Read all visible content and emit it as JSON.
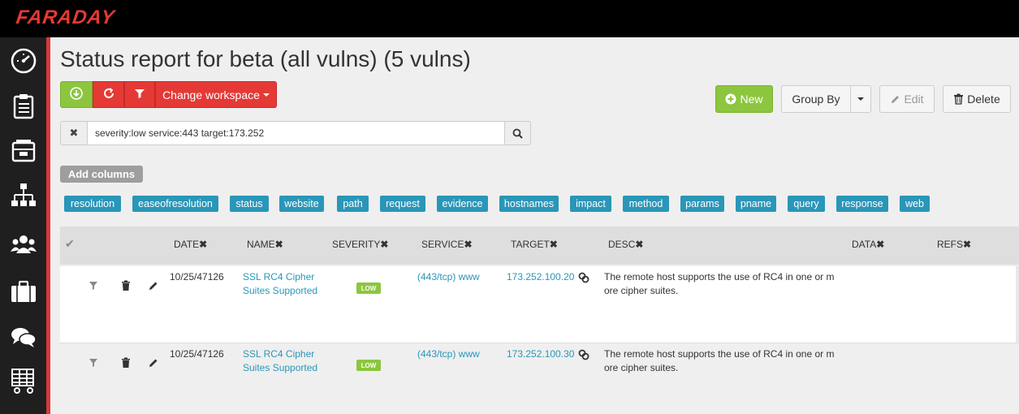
{
  "app": {
    "brand": "FARADAY"
  },
  "page": {
    "title": "Status report for beta (all vulns) (5 vulns)"
  },
  "toolbar": {
    "change_workspace_label": "Change workspace",
    "new_label": "New",
    "group_by_label": "Group By",
    "edit_label": "Edit",
    "delete_label": "Delete"
  },
  "search": {
    "value": "severity:low service:443 target:173.252",
    "clear_glyph": "✖"
  },
  "columns": {
    "add_label": "Add columns",
    "available": [
      "resolution",
      "easeofresolution",
      "status",
      "website",
      "path",
      "request",
      "evidence",
      "hostnames",
      "impact",
      "method",
      "params",
      "pname",
      "query",
      "response",
      "web"
    ]
  },
  "table": {
    "check_glyph": "✔",
    "remove_glyph": "✖",
    "headers": [
      "DATE",
      "NAME",
      "SEVERITY",
      "SERVICE",
      "TARGET",
      "DESC",
      "DATA",
      "REFS"
    ],
    "rows": [
      {
        "date": "10/25/47126",
        "name_line1": "SSL RC4 Cipher",
        "name_line2": "Suites Supported",
        "severity": "LOW",
        "service": "(443/tcp) www",
        "target": "173.252.100.20",
        "desc_line1": "The remote host supports the use of RC4 in one or m",
        "desc_line2": "ore cipher suites."
      },
      {
        "date": "10/25/47126",
        "name_line1": "SSL RC4 Cipher",
        "name_line2": "Suites Supported",
        "severity": "LOW",
        "service": "(443/tcp) www",
        "target": "173.252.100.30",
        "desc_line1": "The remote host supports the use of RC4 in one or m",
        "desc_line2": "ore cipher suites."
      }
    ]
  },
  "colors": {
    "brand_red": "#e53935",
    "accent_green": "#8cc63f",
    "tag_blue": "#2a96b8"
  },
  "icons": {
    "sidebar": [
      "dashboard-icon",
      "clipboard-icon",
      "inbox-icon",
      "hierarchy-icon",
      "users-icon",
      "briefcase-icon",
      "chat-icon",
      "report-cart-icon"
    ],
    "toolbar": [
      "download-icon",
      "refresh-icon",
      "filter-icon",
      "plus-circle-icon",
      "pencil-icon",
      "trash-icon",
      "search-icon"
    ]
  }
}
